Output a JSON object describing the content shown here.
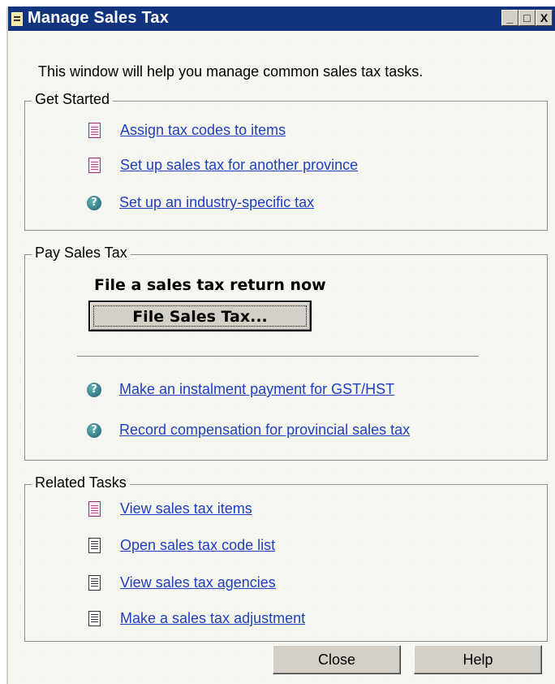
{
  "window": {
    "title": "Manage Sales Tax",
    "controls": {
      "minimize": "_",
      "maximize": "□",
      "close": "X"
    }
  },
  "intro": "This window will help you manage common sales tax tasks.",
  "get_started": {
    "title": "Get Started",
    "items": [
      {
        "label": "Assign tax codes to items",
        "icon": "document-icon"
      },
      {
        "label": "Set up sales tax for another province",
        "icon": "document-icon"
      },
      {
        "label": "Set up an industry-specific tax",
        "icon": "help-icon"
      }
    ]
  },
  "pay_sales_tax": {
    "title": "Pay Sales Tax",
    "file_label": "File a sales tax return now",
    "file_button": "File Sales Tax...",
    "items": [
      {
        "label": "Make an instalment payment for GST/HST",
        "icon": "help-icon"
      },
      {
        "label": "Record compensation for provincial sales tax",
        "icon": "help-icon"
      }
    ]
  },
  "related_tasks": {
    "title": "Related Tasks",
    "items": [
      {
        "label": "View sales tax items",
        "icon": "document-icon"
      },
      {
        "label": "Open sales tax code list",
        "icon": "list-icon"
      },
      {
        "label": "View sales tax agencies",
        "icon": "list-icon"
      },
      {
        "label": "Make a sales tax adjustment",
        "icon": "list-icon"
      }
    ]
  },
  "buttons": {
    "close": "Close",
    "help": "Help"
  }
}
